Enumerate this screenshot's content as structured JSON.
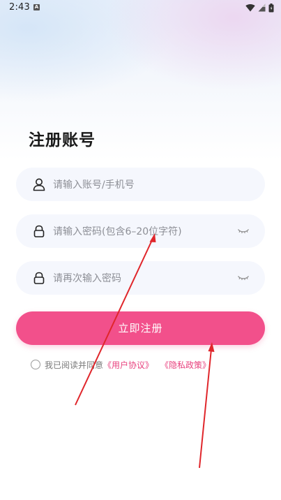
{
  "status_bar": {
    "time": "2:43",
    "notification_icon_label": "A",
    "icons": [
      "wifi-icon",
      "signal-icon",
      "battery-icon"
    ]
  },
  "page": {
    "title": "注册账号"
  },
  "form": {
    "account_placeholder": "请输入账号/手机号",
    "password_placeholder": "请输入密码(包含6–20位字符)",
    "confirm_placeholder": "请再次输入密码",
    "submit_label": "立即注册"
  },
  "agreement": {
    "prefix": "我已阅读并同意",
    "user_agreement": "《用户协议》",
    "privacy_policy": "《隐私政策》"
  },
  "colors": {
    "accent": "#f2508b",
    "link": "#e8417e",
    "annotation": "#e0262b"
  }
}
